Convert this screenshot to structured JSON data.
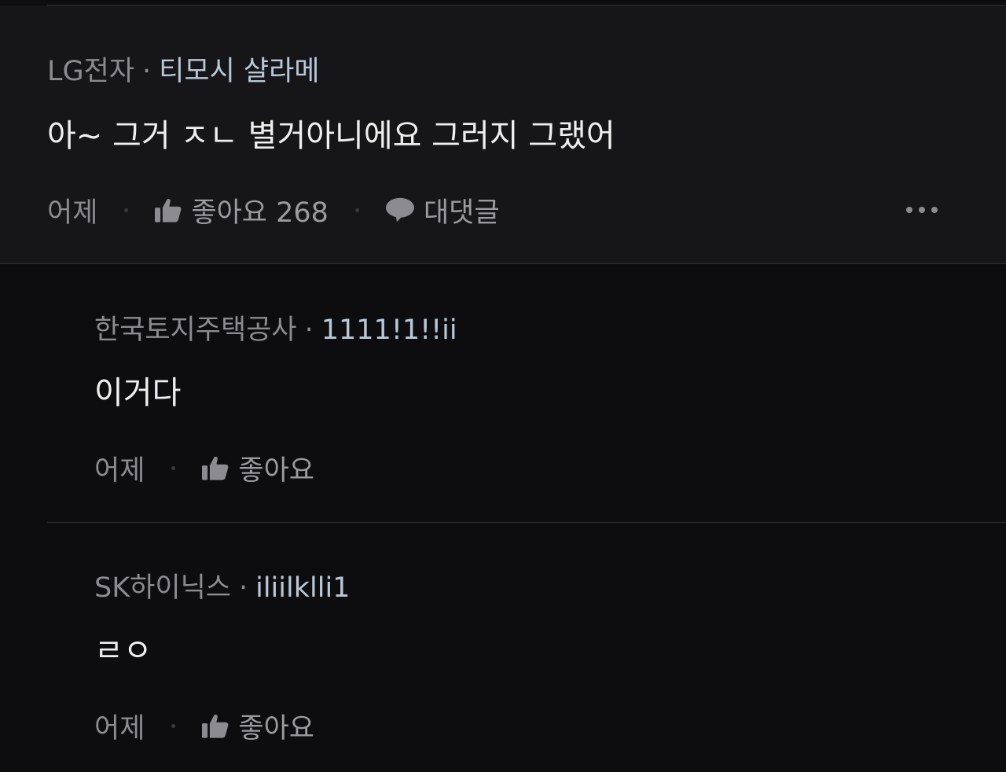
{
  "comments": [
    {
      "org": "LG전자",
      "nick": "티모시 샬라메",
      "text": "아~ 그거 ㅈㄴ 별거아니에요 그러지 그랬어",
      "time": "어제",
      "like_label": "좋아요 268",
      "reply_label": "대댓글",
      "more_icon": "more-dots-icon"
    },
    {
      "org": "한국토지주택공사",
      "nick": "1111!1!!ii",
      "text": "이거다",
      "time": "어제",
      "like_label": "좋아요"
    },
    {
      "org": "SK하이닉스",
      "nick": "iliilklli1",
      "text": "ㄹㅇ",
      "time": "어제",
      "like_label": "좋아요"
    }
  ],
  "separator": "·",
  "icons": {
    "like": "thumbs-up-icon",
    "reply": "speech-bubble-icon"
  },
  "colors": {
    "background": "#0d0d0f",
    "main_comment_bg": "#161618",
    "nickname": "#b9c7d9",
    "org": "#8b8b90"
  }
}
